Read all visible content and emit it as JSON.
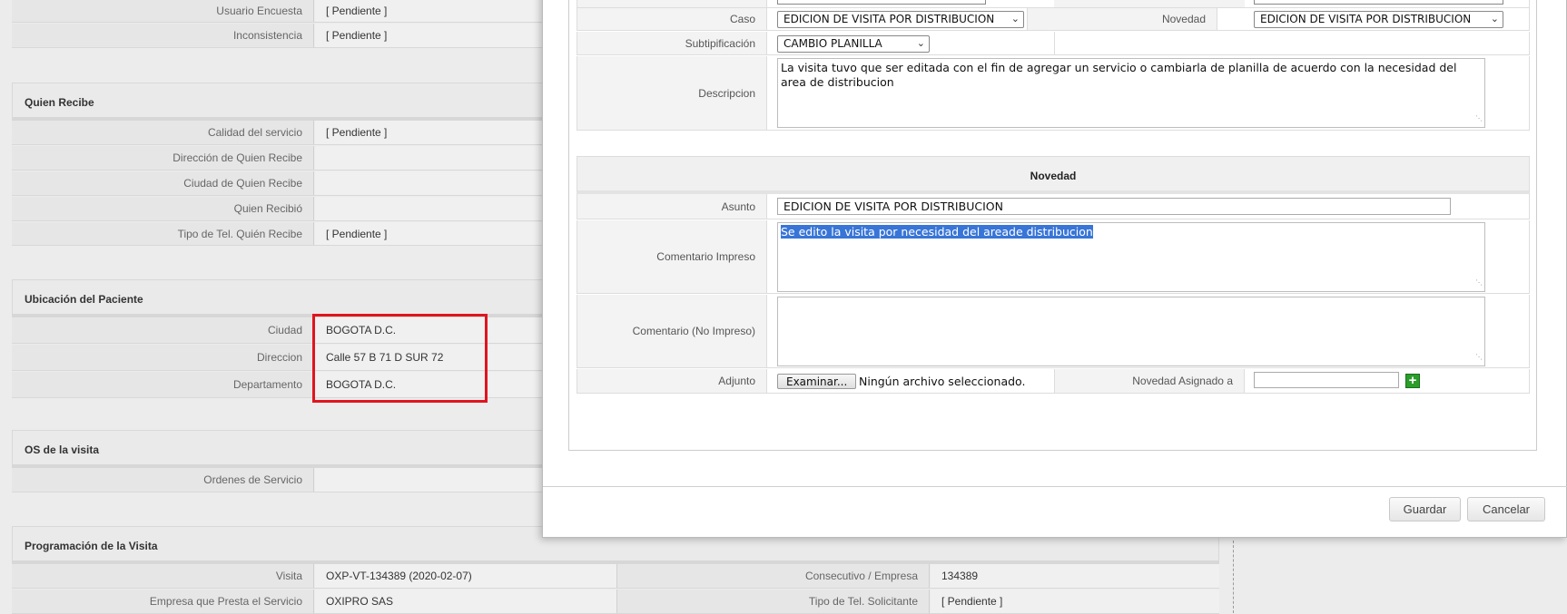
{
  "background": {
    "top_rows": [
      {
        "label": "Usuario Encuesta",
        "value": "[ Pendiente ]"
      },
      {
        "label": "Inconsistencia",
        "value": "[ Pendiente ]"
      }
    ],
    "quien_recibe": {
      "title": "Quien Recibe",
      "rows": [
        {
          "label": "Calidad del servicio",
          "value": "[ Pendiente ]"
        },
        {
          "label": "Dirección de Quien Recibe",
          "value": ""
        },
        {
          "label": "Ciudad de Quien Recibe",
          "value": ""
        },
        {
          "label": "Quien Recibió",
          "value": ""
        },
        {
          "label": "Tipo de Tel. Quién Recibe",
          "value": "[ Pendiente ]"
        }
      ]
    },
    "ubicacion": {
      "title": "Ubicación del Paciente",
      "rows": [
        {
          "label": "Ciudad",
          "value": "BOGOTA D.C."
        },
        {
          "label": "Direccion",
          "value": "Calle 57 B 71 D SUR 72"
        },
        {
          "label": "Departamento",
          "value": "BOGOTA D.C."
        }
      ]
    },
    "os_visita": {
      "title": "OS de la visita",
      "rows": [
        {
          "label": "Ordenes de Servicio",
          "value": ""
        }
      ]
    },
    "programacion": {
      "title": "Programación de la Visita",
      "rows": [
        {
          "label": "Visita",
          "value": "OXP-VT-134389 (2020-02-07)",
          "label2": "Consecutivo / Empresa",
          "value2": "134389"
        },
        {
          "label": "Empresa que Presta el Servicio",
          "value": "OXIPRO SAS",
          "label2": "Tipo de Tel. Solicitante",
          "value2": "[ Pendiente ]"
        }
      ]
    }
  },
  "modal": {
    "caso_label": "Caso",
    "caso_value": "EDICION DE VISITA POR DISTRIBUCION",
    "novedad_label": "Novedad",
    "novedad_value": "EDICION DE VISITA POR DISTRIBUCION",
    "subtipificacion_label": "Subtipificación",
    "subtipificacion_value": "CAMBIO PLANILLA",
    "descripcion_label": "Descripcion",
    "descripcion_value": "La visita tuvo que ser editada con el fin de agregar un servicio o cambiarla de planilla de acuerdo con la necesidad del area de distribucion",
    "novedad_section_title": "Novedad",
    "asunto_label": "Asunto",
    "asunto_value": "EDICION DE VISITA POR DISTRIBUCION",
    "comentario_impreso_label": "Comentario Impreso",
    "comentario_impreso_value": "Se edito la visita por necesidad del areade distribucion",
    "comentario_no_impreso_label": "Comentario (No Impreso)",
    "comentario_no_impreso_value": "",
    "adjunto_label": "Adjunto",
    "examinar_button": "Examinar...",
    "file_status": "Ningún archivo seleccionado.",
    "novedad_asignado_label": "Novedad Asignado a",
    "novedad_asignado_value": "",
    "guardar_button": "Guardar",
    "cancelar_button": "Cancelar"
  },
  "colors": {
    "highlight_border": "#e0141e",
    "selection": "#3875d7",
    "add_icon": "#2a9d2a"
  },
  "icons": {
    "dropdown": "chevron-down-icon",
    "add": "plus-icon",
    "resize": "resize-grip-icon"
  }
}
